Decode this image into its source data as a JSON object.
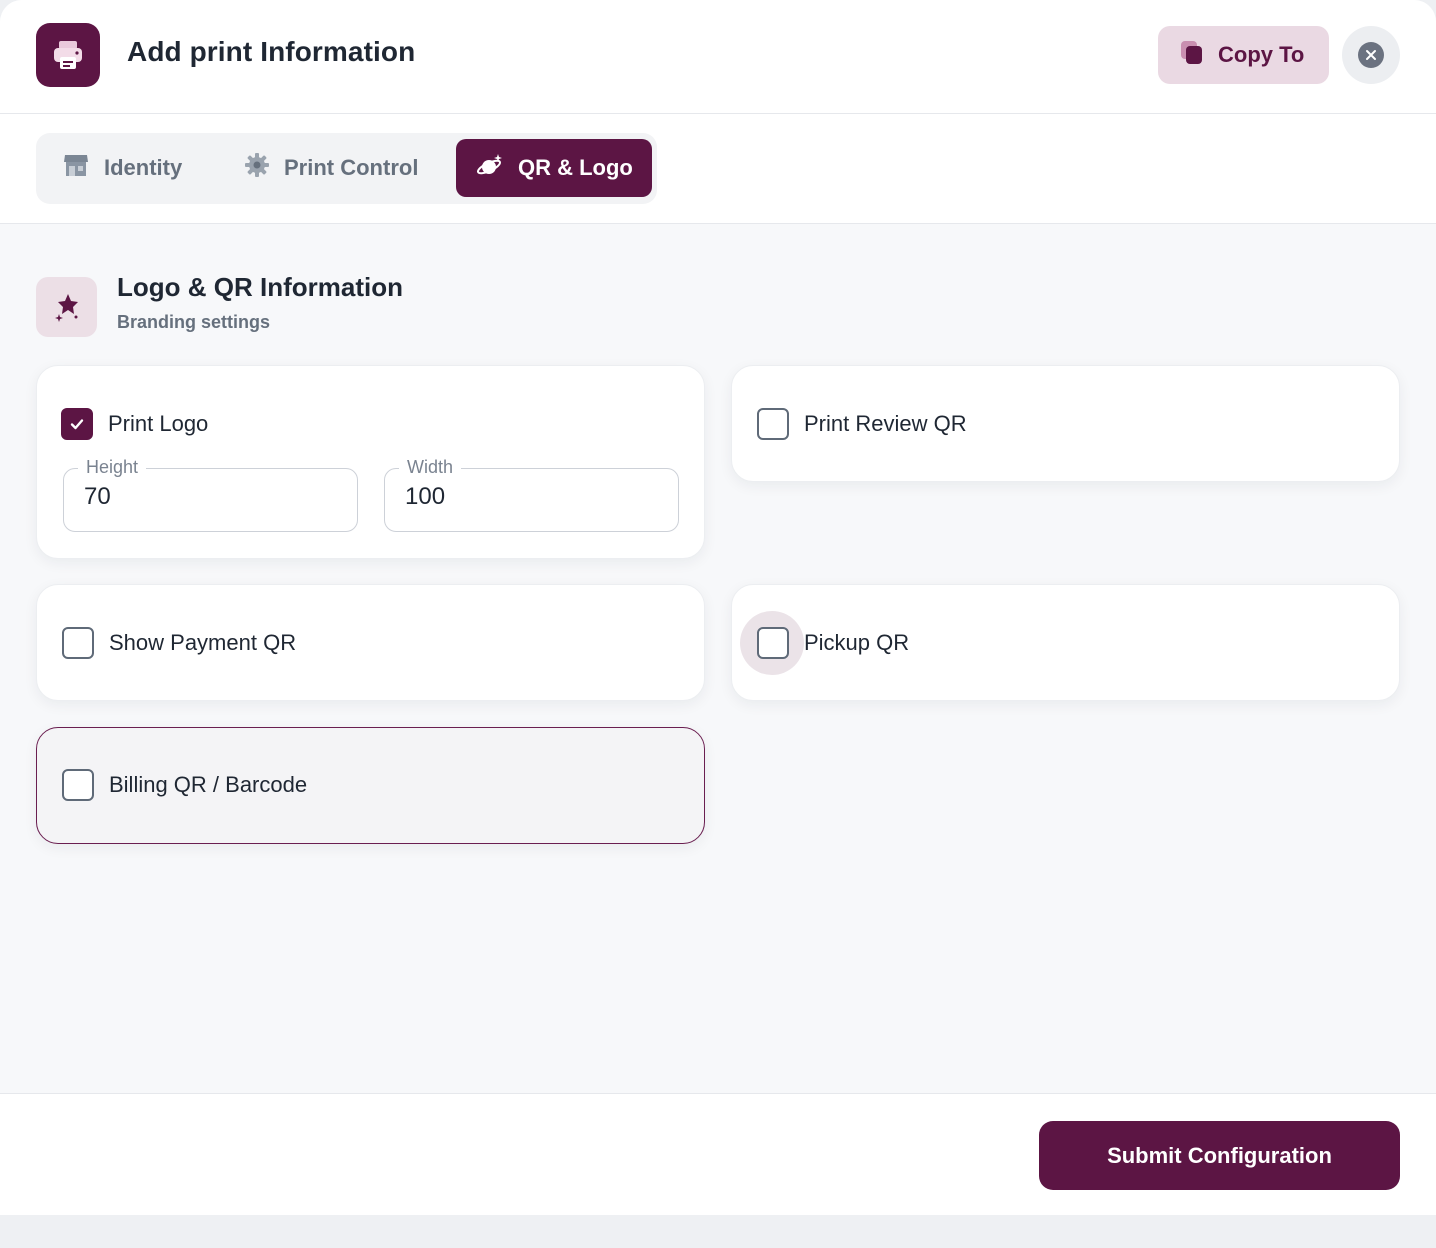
{
  "header": {
    "title": "Add print Information",
    "icon": "printer-icon",
    "copy_label": "Copy To",
    "copy_icon": "copy-icon",
    "close_icon": "close-icon"
  },
  "tabs": [
    {
      "label": "Identity",
      "icon": "store-icon",
      "active": false
    },
    {
      "label": "Print Control",
      "icon": "gear-icon",
      "active": false
    },
    {
      "label": "QR & Logo",
      "icon": "planet-icon",
      "active": true
    }
  ],
  "section": {
    "title": "Logo & QR Information",
    "subtitle": "Branding settings",
    "icon": "sparkle-star-icon"
  },
  "options": {
    "print_logo": {
      "label": "Print Logo",
      "checked": true
    },
    "print_review_qr": {
      "label": "Print Review QR",
      "checked": false
    },
    "show_payment_qr": {
      "label": "Show Payment QR",
      "checked": false
    },
    "pickup_qr": {
      "label": "Pickup QR",
      "checked": false
    },
    "billing_qr": {
      "label": "Billing QR / Barcode",
      "checked": false
    }
  },
  "logo_size": {
    "height_label": "Height",
    "height_value": "70",
    "width_label": "Width",
    "width_value": "100"
  },
  "footer": {
    "submit_label": "Submit Configuration"
  },
  "colors": {
    "brand": "#5c1544",
    "brand_soft": "#ead9e3",
    "background": "#f7f8fa"
  }
}
